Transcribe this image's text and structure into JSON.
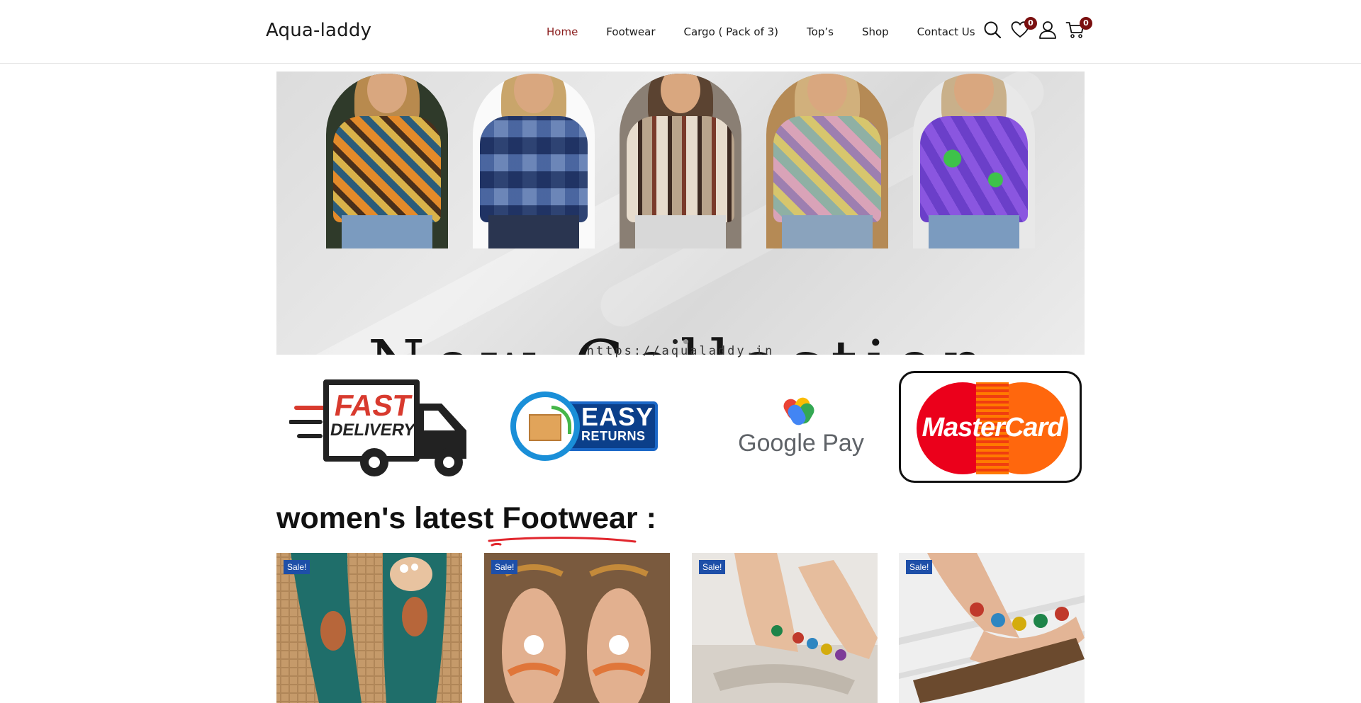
{
  "header": {
    "logo": "Aqua-laddy",
    "nav": [
      {
        "label": "Home",
        "active": true
      },
      {
        "label": "Footwear",
        "active": false
      },
      {
        "label": "Cargo ( Pack of 3)",
        "active": false
      },
      {
        "label": "Top’s",
        "active": false
      },
      {
        "label": "Shop",
        "active": false
      },
      {
        "label": "Contact Us",
        "active": false
      }
    ],
    "icons": {
      "search": "search-icon",
      "wishlist": "heart-icon",
      "account": "user-icon",
      "cart": "cart-icon"
    },
    "wishlist_count": "0",
    "cart_count": "0",
    "accent_color": "#8a1c1c",
    "badge_color": "#7a0f0f"
  },
  "hero": {
    "title": "New Collection",
    "url": "https://aqualaddy.in",
    "slides": 2,
    "active_slide": 1
  },
  "features": {
    "fast_delivery": {
      "line1": "FAST",
      "line2": "DELIVERY"
    },
    "easy_returns": {
      "line1": "EASY",
      "line2": "RETURNS"
    },
    "google_pay": {
      "label": "Google Pay"
    },
    "mastercard": {
      "label": "MasterCard"
    }
  },
  "section": {
    "title_prefix": "women's latest ",
    "title_highlight": "Footwear :"
  },
  "products": [
    {
      "badge": "Sale!"
    },
    {
      "badge": "Sale!"
    },
    {
      "badge": "Sale!"
    },
    {
      "badge": "Sale!"
    }
  ]
}
